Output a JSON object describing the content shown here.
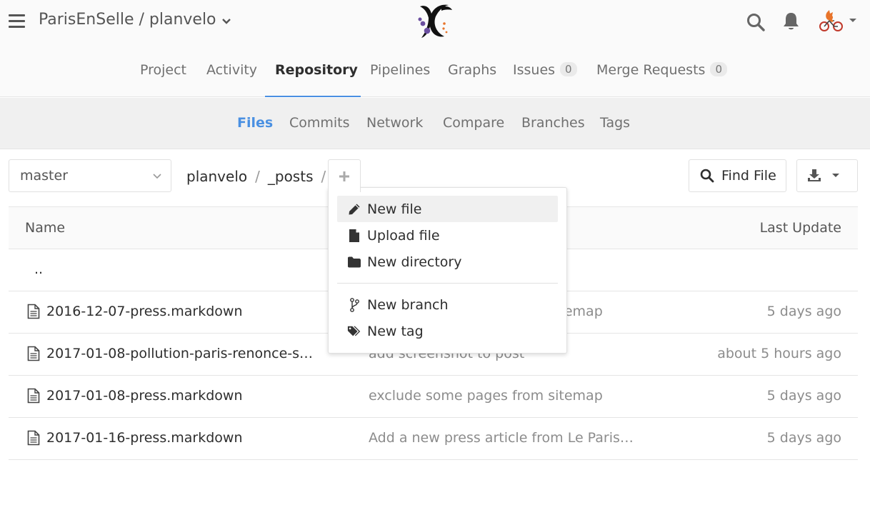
{
  "header": {
    "project_path": "ParisEnSelle / planvelo",
    "logo_icon": "parisenselle-logo",
    "search_icon": "search-icon",
    "notifications_icon": "bell-icon",
    "avatar_icon": "cyclist-fox-avatar"
  },
  "nav": {
    "tabs": [
      {
        "label": "Project"
      },
      {
        "label": "Activity"
      },
      {
        "label": "Repository",
        "active": true
      },
      {
        "label": "Pipelines"
      },
      {
        "label": "Graphs"
      },
      {
        "label": "Issues",
        "count": "0"
      },
      {
        "label": "Merge Requests",
        "count": "0"
      }
    ]
  },
  "subnav": {
    "tabs": [
      {
        "label": "Files",
        "active": true
      },
      {
        "label": "Commits"
      },
      {
        "label": "Network"
      },
      {
        "label": "Compare"
      },
      {
        "label": "Branches"
      },
      {
        "label": "Tags"
      }
    ]
  },
  "toolbar": {
    "branch": "master",
    "breadcrumb": [
      "planvelo",
      "_posts"
    ],
    "breadcrumb_separator": "/",
    "find_file_label": "Find File"
  },
  "dropdown": {
    "items": [
      {
        "label": "New file",
        "icon": "pencil-icon"
      },
      {
        "label": "Upload file",
        "icon": "file-icon"
      },
      {
        "label": "New directory",
        "icon": "folder-icon"
      }
    ],
    "items2": [
      {
        "label": "New branch",
        "icon": "branch-icon"
      },
      {
        "label": "New tag",
        "icon": "tags-icon"
      }
    ]
  },
  "table": {
    "headers": {
      "name": "Name",
      "last_update": "Last Update"
    },
    "parent": "..",
    "rows": [
      {
        "name": "2016-12-07-press.markdown",
        "message": "exclude some pages from sitemap",
        "updated": "5 days ago"
      },
      {
        "name": "2017-01-08-pollution-paris-renonce-s…",
        "message": "add screenshot to post",
        "updated": "about 5 hours ago"
      },
      {
        "name": "2017-01-08-press.markdown",
        "message": "exclude some pages from sitemap",
        "updated": "5 days ago"
      },
      {
        "name": "2017-01-16-press.markdown",
        "message": "Add a new press article from Le Paris…",
        "updated": "5 days ago"
      }
    ]
  }
}
